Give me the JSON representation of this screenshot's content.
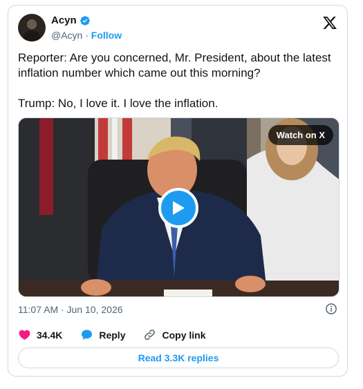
{
  "author": {
    "name": "Acyn",
    "handle": "@Acyn",
    "separator": "·",
    "follow_label": "Follow"
  },
  "tweet": {
    "text": "Reporter: Are you concerned, Mr. President, about the latest inflation number which came out this morning?\n\nTrump: No, I love it. I love the inflation.",
    "timestamp": "11:07 AM · Jun 10, 2026"
  },
  "media": {
    "watch_label": "Watch on X",
    "play_icon": "play-icon"
  },
  "actions": {
    "likes": "34.4K",
    "reply_label": "Reply",
    "copy_label": "Copy link"
  },
  "read_replies_label": "Read 3.3K replies",
  "colors": {
    "accent": "#1d9bf0",
    "like": "#f91880",
    "muted": "#536471",
    "border": "#cfd9de"
  }
}
